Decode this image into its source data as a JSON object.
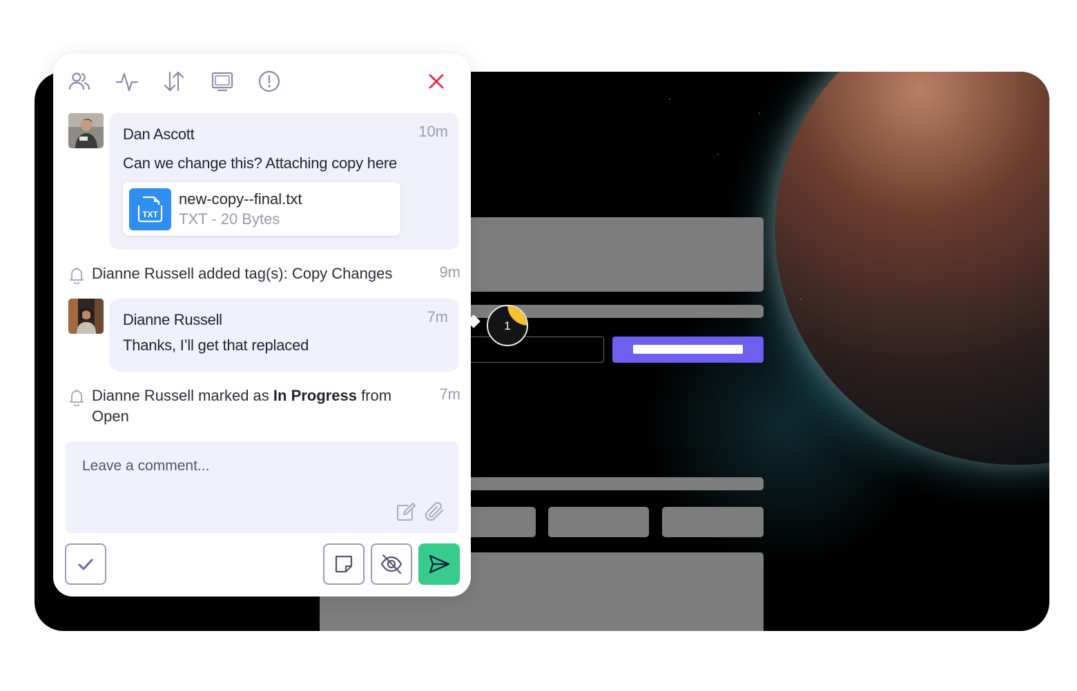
{
  "toolbar": {
    "icons": [
      "people-icon",
      "activity-icon",
      "sort-icon",
      "screen-icon",
      "info-icon",
      "close-icon"
    ],
    "close_color": "#e8294f"
  },
  "thread": {
    "comment1": {
      "author": "Dan Ascott",
      "time": "10m",
      "text": "Can we change this? Attaching copy here",
      "attachment": {
        "type_label": "TXT",
        "filename": "new-copy--final.txt",
        "meta": "TXT - 20 Bytes"
      }
    },
    "activity1": {
      "text": "Dianne Russell added tag(s): Copy Changes",
      "time": "9m"
    },
    "comment2": {
      "author": "Dianne Russell",
      "time": "7m",
      "text": "Thanks, I’ll get that replaced"
    },
    "activity2": {
      "prefix": "Dianne Russell marked as ",
      "status": "In Progress",
      "suffix": " from Open",
      "time": "7m"
    }
  },
  "composer": {
    "placeholder": "Leave a comment..."
  },
  "marker": {
    "number": "1"
  },
  "colors": {
    "accent": "#6e5ff0",
    "send": "#35cc8c",
    "bubble": "#f1f1fb",
    "marker_wedge": "#f5c22a"
  }
}
